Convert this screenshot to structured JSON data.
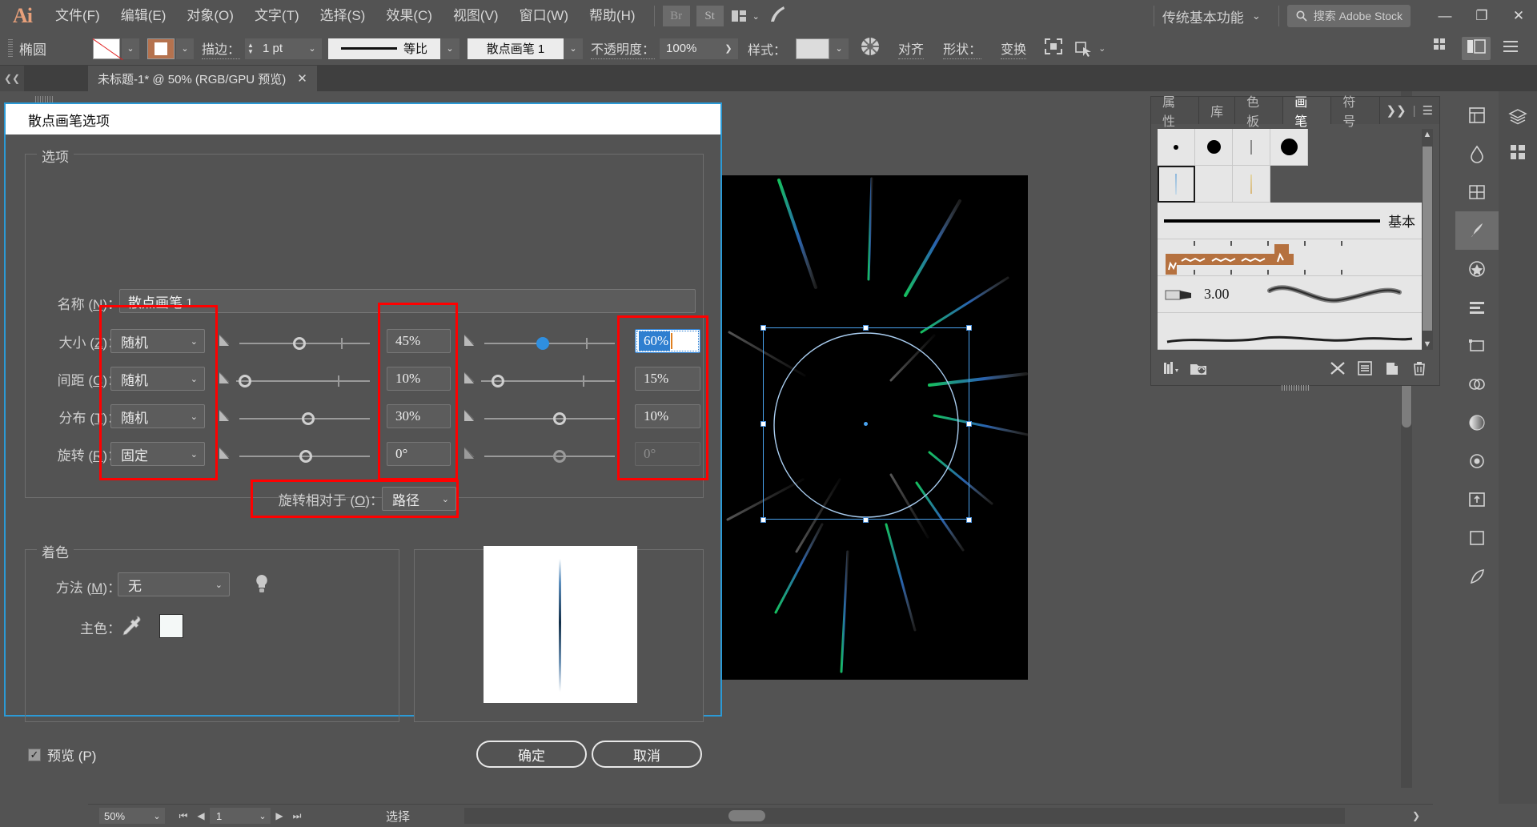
{
  "app": {
    "logo": "Ai",
    "workspace": "传统基本功能",
    "search_placeholder": "搜索 Adobe Stock"
  },
  "menubar": {
    "items": [
      "文件(F)",
      "编辑(E)",
      "对象(O)",
      "文字(T)",
      "选择(S)",
      "效果(C)",
      "视图(V)",
      "窗口(W)",
      "帮助(H)"
    ],
    "bridge": "Br",
    "stock": "St",
    "window_controls": {
      "minimize": "—",
      "maximize": "❐",
      "close": "✕"
    }
  },
  "controlbar": {
    "tool_name": "椭圆",
    "stroke_label": "描边：",
    "stroke_weight": "1 pt",
    "profile_label": "等比",
    "brush_name": "散点画笔 1",
    "opacity_label": "不透明度：",
    "opacity_value": "100%",
    "opacity_arrow": "❯",
    "style_label": "样式：",
    "align_label": "对齐",
    "shape_label": "形状：",
    "transform_label": "变换"
  },
  "tabbar": {
    "doc_title": "未标题-1* @ 50% (RGB/GPU 预览)",
    "close": "✕"
  },
  "statusbar": {
    "zoom": "50%",
    "page": "1",
    "status_text": "选择",
    "first": "⏮",
    "prev": "◀",
    "next": "▶",
    "last": "⏭",
    "arrow": "▶",
    "chev": "❮",
    "chev_right": "❯"
  },
  "dialog": {
    "title": "散点画笔选项",
    "options_legend": "选项",
    "name_label": "名称 (N)：",
    "name_value": "散点画笔 1",
    "rows": [
      {
        "label_pre": "大小 (",
        "mnemonic": "Z",
        "label_post": ")：",
        "select": "随机",
        "val_left": "45%",
        "val_right": "60%",
        "left_knob_pct": 46,
        "right_knob_pct": 38,
        "left_filled": false,
        "right_filled": true,
        "right_editing": true
      },
      {
        "label_pre": "间距 (",
        "mnemonic": "C",
        "label_post": ")：",
        "select": "随机",
        "val_left": "10%",
        "val_right": "15%",
        "left_knob_pct": 8,
        "right_knob_pct": 14,
        "left_filled": false,
        "right_filled": false,
        "right_editing": false
      },
      {
        "label_pre": "分布 (",
        "mnemonic": "T",
        "label_post": ")：",
        "select": "随机",
        "val_left": "30%",
        "val_right": "10%",
        "left_knob_pct": 43,
        "right_knob_pct": 55,
        "left_filled": false,
        "right_filled": false,
        "right_editing": false
      },
      {
        "label_pre": "旋转 (",
        "mnemonic": "R",
        "label_post": ")：",
        "select": "固定",
        "val_left": "0°",
        "val_right": "0°",
        "left_knob_pct": 42,
        "right_knob_pct": 55,
        "left_filled": false,
        "right_filled": false,
        "right_editing": false,
        "right_disabled": true
      }
    ],
    "rotate_relative_label": "旋转相对于 (O)：",
    "rotate_relative_value": "路径",
    "colorize_legend": "着色",
    "method_label": "方法 (M)：",
    "method_value": "无",
    "main_color_label": "主色：",
    "main_color_hex": "#f4f8f7",
    "preview_label": "预览 (P)",
    "preview_checked": true,
    "ok_label": "确定",
    "cancel_label": "取消"
  },
  "brush_panel": {
    "tabs": [
      "属性",
      "库",
      "色板",
      "画笔",
      "符号"
    ],
    "active_tab": "画笔",
    "overflow": "❯❯",
    "menu": "☰",
    "basic_label": "基本",
    "charcoal_value": "3.00",
    "footer_icons": [
      "brush-libraries-icon",
      "creative-cloud-libraries-icon",
      "remove-brush-stroke-icon",
      "options-icon",
      "new-brush-icon",
      "delete-brush-icon"
    ]
  },
  "colors": {
    "accent": "#2b9ad6",
    "highlight_red": "#ff0000",
    "slider_blue": "#2f8fe0",
    "panel_bg": "#535353"
  }
}
